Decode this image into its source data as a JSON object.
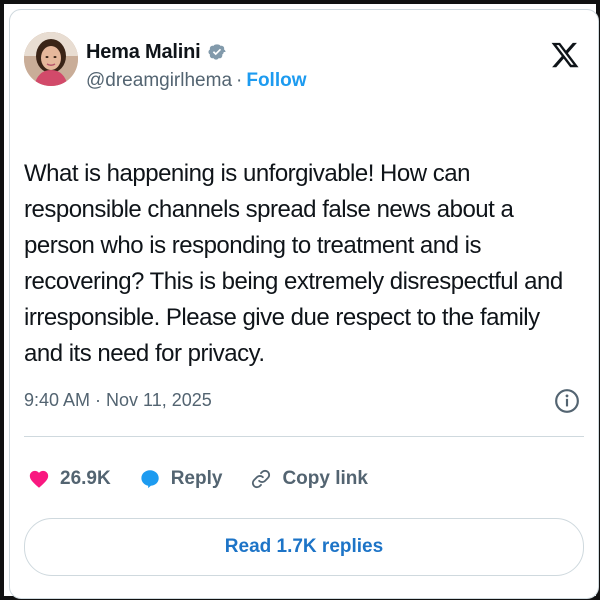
{
  "author": {
    "name": "Hema Malini",
    "handle": "@dreamgirlhema",
    "separator": "·",
    "follow_label": "Follow",
    "verified": true,
    "avatar_icon": "profile-photo"
  },
  "brand": {
    "logo_icon": "x-logo"
  },
  "tweet": {
    "text": "What is happening is unforgivable! How can responsible channels spread false news about a person who is responding to treatment and is recovering? This is being extremely disrespectful and  irresponsible. Please give due respect to the family and its need for privacy.",
    "timestamp": "9:40 AM · Nov 11, 2025",
    "info_icon": "info-icon"
  },
  "actions": {
    "likes_count": "26.9K",
    "reply_label": "Reply",
    "copy_link_label": "Copy link"
  },
  "replies": {
    "read_label": "Read 1.7K replies"
  },
  "colors": {
    "accent": "#1d9bf0",
    "like": "#f91880",
    "text_primary": "#0f1419",
    "text_secondary": "#536471",
    "border": "#cfd9de"
  }
}
